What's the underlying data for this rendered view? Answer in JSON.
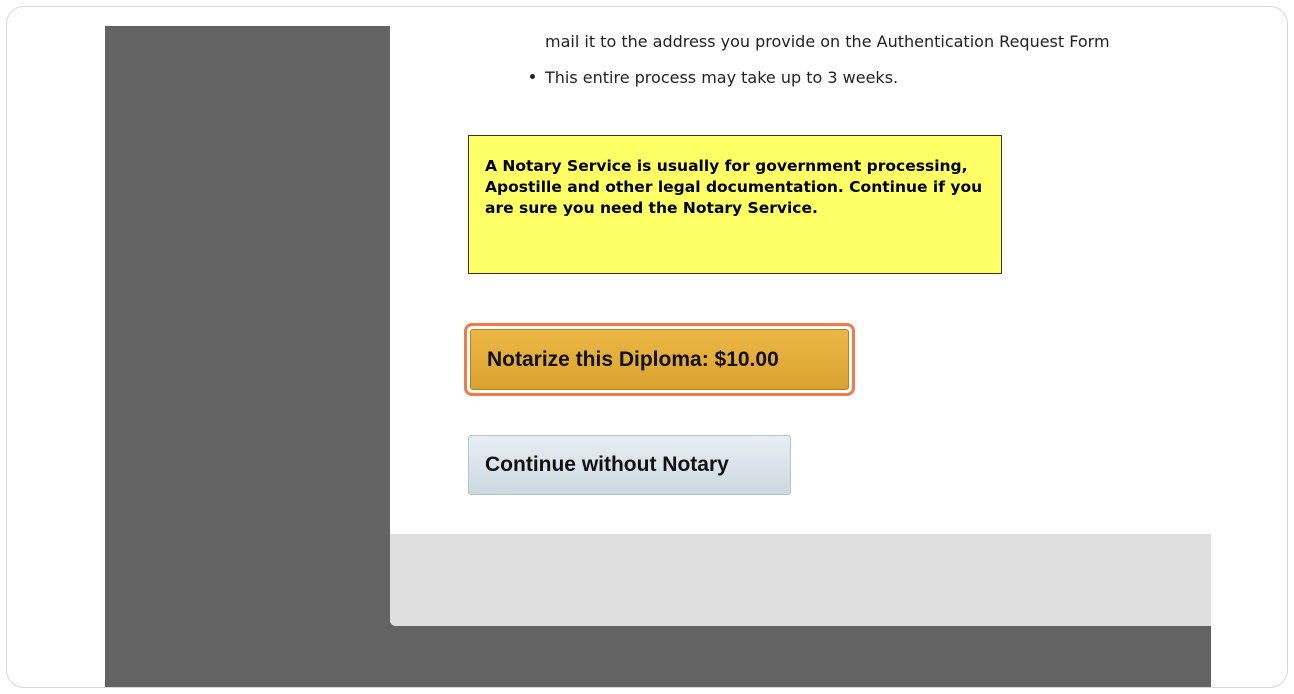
{
  "content": {
    "address_line": "mail it to the address you provide on the Authentication Request Form",
    "bullet_text": "This entire process may take up to 3 weeks.",
    "notice_text": "A Notary Service is usually for government processing, Apostille and other legal documentation. Continue if you are sure you need the Notary Service."
  },
  "buttons": {
    "notarize_label": "Notarize this Diploma: $10.00",
    "continue_label": "Continue without Notary"
  },
  "colors": {
    "notice_background": "#ffff66",
    "notarize_button": "#e3ad3c",
    "highlight_outline": "#f07a4a",
    "continue_button": "#d9e3ea",
    "viewport_background": "#636363",
    "footer_background": "#dedede"
  }
}
